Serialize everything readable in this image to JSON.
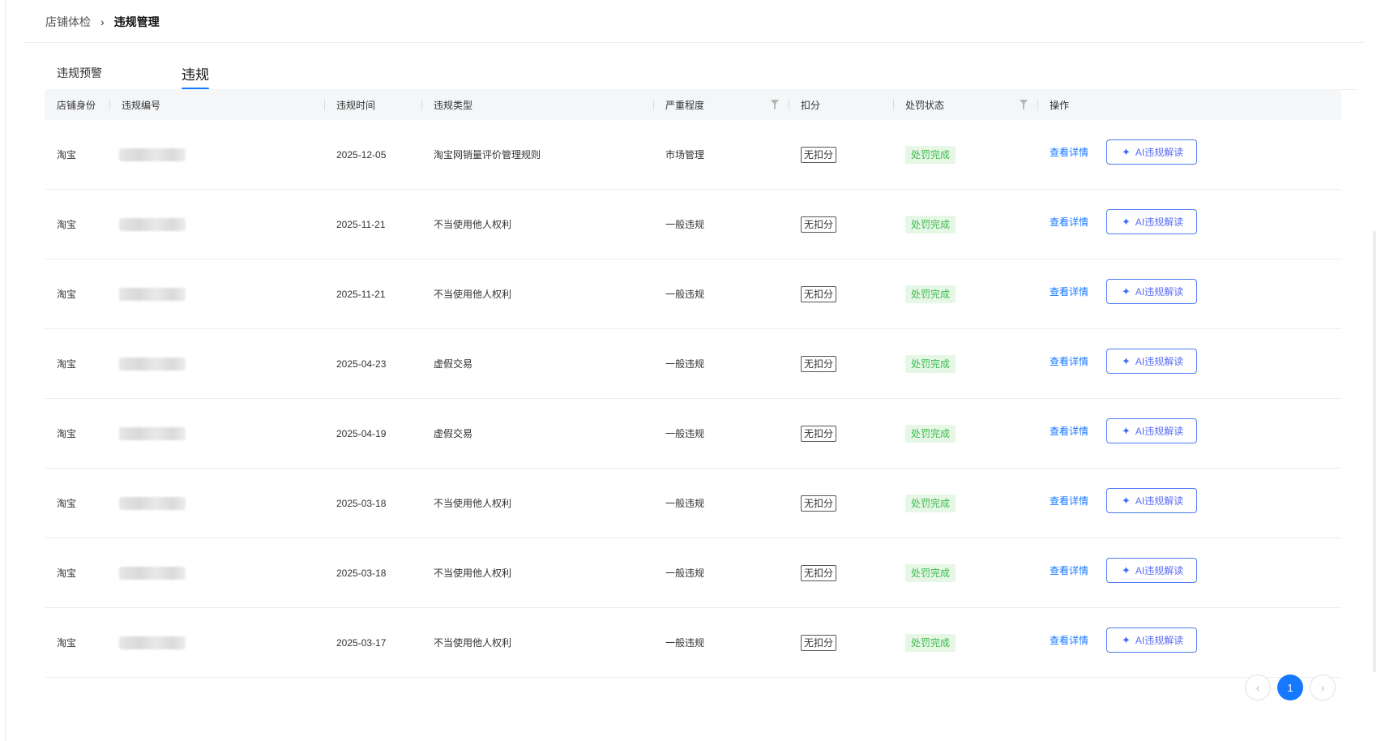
{
  "breadcrumb": {
    "parent": "店铺体检",
    "separator": "›",
    "current": "违规管理"
  },
  "tabs": [
    {
      "label": "违规预警",
      "active": false
    },
    {
      "label": "违规",
      "active": true
    }
  ],
  "table": {
    "columns": [
      "店铺身份",
      "违规编号",
      "违规时间",
      "违规类型",
      "严重程度",
      "扣分",
      "处罚状态",
      "操作"
    ],
    "rows": [
      {
        "identity": "淘宝",
        "id_masked": true,
        "time": "2025-12-05",
        "type": "淘宝网销量评价管理规则",
        "severity": "市场管理",
        "score": "无扣分",
        "status": "处罚完成",
        "detail": "查看详情",
        "ai": "AI违规解读"
      },
      {
        "identity": "淘宝",
        "id_masked": true,
        "time": "2025-11-21",
        "type": "不当使用他人权利",
        "severity": "一般违规",
        "score": "无扣分",
        "status": "处罚完成",
        "detail": "查看详情",
        "ai": "AI违规解读"
      },
      {
        "identity": "淘宝",
        "id_masked": true,
        "time": "2025-11-21",
        "type": "不当使用他人权利",
        "severity": "一般违规",
        "score": "无扣分",
        "status": "处罚完成",
        "detail": "查看详情",
        "ai": "AI违规解读"
      },
      {
        "identity": "淘宝",
        "id_masked": true,
        "time": "2025-04-23",
        "type": "虚假交易",
        "severity": "一般违规",
        "score": "无扣分",
        "status": "处罚完成",
        "detail": "查看详情",
        "ai": "AI违规解读"
      },
      {
        "identity": "淘宝",
        "id_masked": true,
        "time": "2025-04-19",
        "type": "虚假交易",
        "severity": "一般违规",
        "score": "无扣分",
        "status": "处罚完成",
        "detail": "查看详情",
        "ai": "AI违规解读"
      },
      {
        "identity": "淘宝",
        "id_masked": true,
        "time": "2025-03-18",
        "type": "不当使用他人权利",
        "severity": "一般违规",
        "score": "无扣分",
        "status": "处罚完成",
        "detail": "查看详情",
        "ai": "AI违规解读"
      },
      {
        "identity": "淘宝",
        "id_masked": true,
        "time": "2025-03-18",
        "type": "不当使用他人权利",
        "severity": "一般违规",
        "score": "无扣分",
        "status": "处罚完成",
        "detail": "查看详情",
        "ai": "AI违规解读"
      },
      {
        "identity": "淘宝",
        "id_masked": true,
        "time": "2025-03-17",
        "type": "不当使用他人权利",
        "severity": "一般违规",
        "score": "无扣分",
        "status": "处罚完成",
        "detail": "查看详情",
        "ai": "AI违规解读"
      }
    ]
  },
  "pagination": {
    "prev_icon": "chevron-left-icon",
    "current_page": "1",
    "next_icon": "chevron-right-icon"
  },
  "colors": {
    "accent": "#1677ff",
    "status_green": "#3dbb4d",
    "status_green_bg": "#e6f7e6",
    "ai_button": "#5a6cf5"
  }
}
